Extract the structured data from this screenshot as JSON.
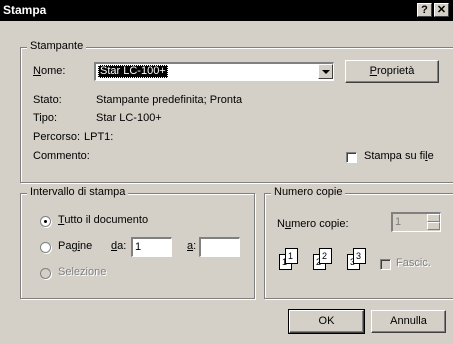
{
  "window": {
    "title": "Stampa",
    "help_glyph": "?",
    "close_glyph": "✕"
  },
  "printer": {
    "group_label": "Stampante",
    "name_label": "Nome:",
    "name_value": "Star LC-100+",
    "properties_button": "Proprietà",
    "status_label": "Stato:",
    "status_value": "Stampante predefinita; Pronta",
    "type_label": "Tipo:",
    "type_value": "Star LC-100+",
    "path_label": "Percorso:",
    "path_value": "LPT1:",
    "comment_label": "Commento:",
    "print_to_file_label": "Stampa su file"
  },
  "range": {
    "group_label": "Intervallo di stampa",
    "all_label": "Tutto il documento",
    "pages_label": "Pagine",
    "from_label": "da:",
    "from_value": "1",
    "to_label": "a:",
    "to_value": "",
    "selection_label": "Selezione"
  },
  "copies": {
    "group_label": "Numero copie",
    "count_label": "Numero copie:",
    "count_value": "1",
    "collate_label": "Fascic.",
    "page_numbers": [
      "1",
      "1",
      "2",
      "2",
      "3",
      "3"
    ]
  },
  "buttons": {
    "ok": "OK",
    "cancel": "Annulla"
  }
}
